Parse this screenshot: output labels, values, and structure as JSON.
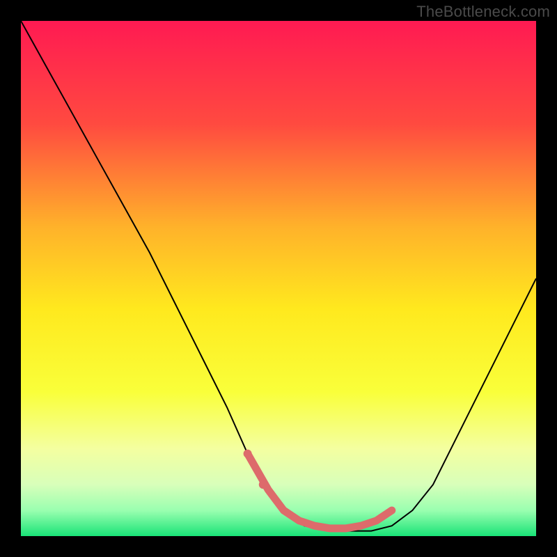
{
  "watermark": "TheBottleneck.com",
  "chart_data": {
    "type": "line",
    "title": "",
    "xlabel": "",
    "ylabel": "",
    "xlim": [
      0,
      100
    ],
    "ylim": [
      0,
      100
    ],
    "series": [
      {
        "name": "gradient-background",
        "type": "area",
        "stops": [
          {
            "pos": 0.0,
            "color": "#ff1a52"
          },
          {
            "pos": 0.2,
            "color": "#ff4a40"
          },
          {
            "pos": 0.4,
            "color": "#ffb22a"
          },
          {
            "pos": 0.56,
            "color": "#ffe91e"
          },
          {
            "pos": 0.72,
            "color": "#f9ff3a"
          },
          {
            "pos": 0.83,
            "color": "#f4ffa0"
          },
          {
            "pos": 0.9,
            "color": "#d8ffba"
          },
          {
            "pos": 0.95,
            "color": "#9affb0"
          },
          {
            "pos": 1.0,
            "color": "#19e377"
          }
        ]
      },
      {
        "name": "bottleneck-curve",
        "x": [
          0,
          5,
          10,
          15,
          20,
          25,
          30,
          35,
          40,
          44,
          48,
          51,
          55,
          60,
          65,
          68,
          72,
          76,
          80,
          84,
          88,
          92,
          96,
          100
        ],
        "values": [
          100,
          91,
          82,
          73,
          64,
          55,
          45,
          35,
          25,
          16,
          9,
          5,
          2,
          1,
          1,
          1,
          2,
          5,
          10,
          18,
          26,
          34,
          42,
          50
        ],
        "stroke": "#000000"
      },
      {
        "name": "marker-band",
        "x": [
          44,
          48,
          51,
          54,
          57,
          60,
          63,
          66,
          69,
          72
        ],
        "values": [
          16,
          9,
          5,
          3,
          2,
          1.5,
          1.5,
          2,
          3,
          5
        ],
        "stroke": "#dd6b6b"
      }
    ]
  }
}
